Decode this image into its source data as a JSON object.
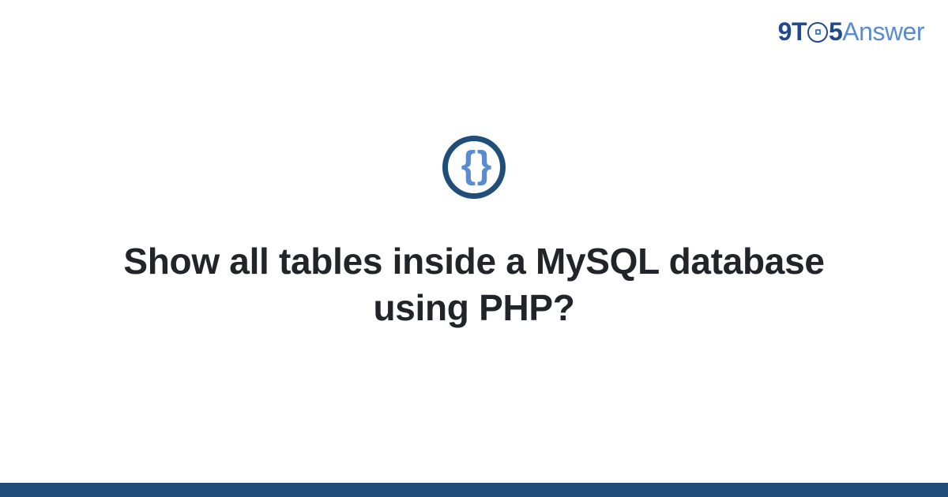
{
  "logo": {
    "part1": "9T",
    "part2": "5",
    "part3": "Answer"
  },
  "badge": {
    "symbol": "{ }"
  },
  "main": {
    "title": "Show all tables inside a MySQL database using PHP?"
  },
  "colors": {
    "brand_dark": "#1f4e79",
    "brand_light": "#5a8bd0",
    "text": "#212529"
  }
}
